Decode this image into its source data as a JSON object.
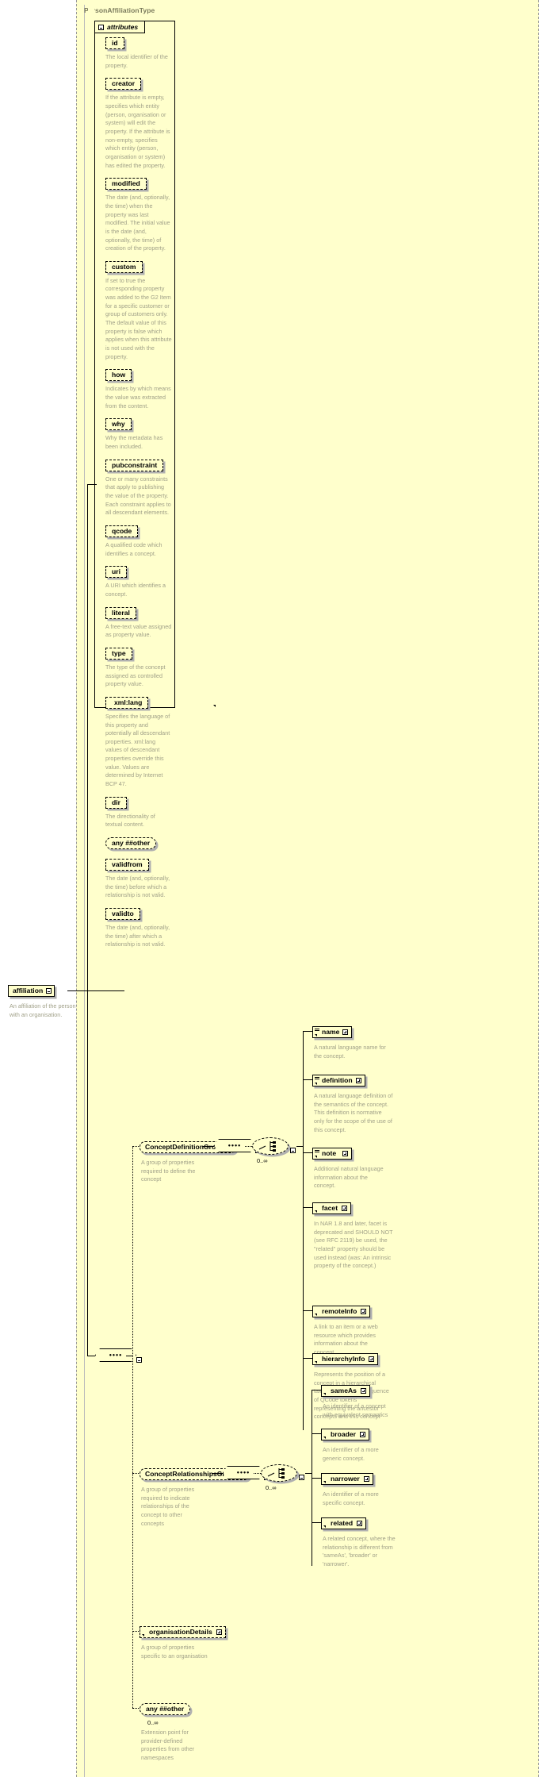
{
  "diagram": {
    "type": "xml-schema-diagram",
    "root_type": "PersonAffiliationType",
    "attributes_tab_label": "attributes",
    "source_element": {
      "name": "affiliation",
      "desc": "An affiliation of the person with an organisation."
    },
    "attributes": [
      {
        "name": "id",
        "desc": "The local identifier of the property."
      },
      {
        "name": "creator",
        "desc": "If the attribute is empty, specifies which entity (person, organisation or system) will edit the property. If the attribute is non-empty, specifies which entity (person, organisation or system) has edited the property."
      },
      {
        "name": "modified",
        "desc": "The date (and, optionally, the time) when the property was last modified. The initial value is the date (and, optionally, the time) of creation of the property."
      },
      {
        "name": "custom",
        "desc": "If set to true the corresponding property was added to the G2 Item for a specific customer or group of customers only. The default value of this property is false which applies when this attribute is not used with the property."
      },
      {
        "name": "how",
        "desc": "Indicates by which means the value was extracted from the content."
      },
      {
        "name": "why",
        "desc": "Why the metadata has been included."
      },
      {
        "name": "pubconstraint",
        "desc": "One or many constraints that apply to publishing the value of the property. Each constraint applies to all descendant elements."
      },
      {
        "name": "qcode",
        "desc": "A qualified code which identifies a concept."
      },
      {
        "name": "uri",
        "desc": "A URI which identifies a concept."
      },
      {
        "name": "literal",
        "desc": "A free-text value assigned as property value."
      },
      {
        "name": "type",
        "desc": "The type of the concept assigned as controlled property value."
      },
      {
        "name": "xml:lang",
        "desc": "Specifies the language of this property and potentially all descendant properties. xml:lang values of descendant properties override this value. Values are determined by Internet BCP 47."
      },
      {
        "name": "dir",
        "desc": "The directionality of textual content."
      },
      {
        "name": "any ##other",
        "kind": "any-attribute",
        "desc": ""
      },
      {
        "name": "validfrom",
        "desc": "The date (and, optionally, the time) before which a relationship is not valid."
      },
      {
        "name": "validto",
        "desc": "The date (and, optionally, the time) after which a relationship is not valid."
      }
    ],
    "groups": [
      {
        "name": "ConceptDefinitionGroup",
        "desc": "A group of properties required to define the concept",
        "occurrence": "0..∞",
        "children": [
          {
            "name": "name",
            "desc": "A natural language name for the concept."
          },
          {
            "name": "definition",
            "desc": "A natural language definition of the semantics of the concept. This definition is normative only for the scope of the use of this concept."
          },
          {
            "name": "note",
            "desc": "Additional natural language information about the concept."
          },
          {
            "name": "facet",
            "desc": "In NAR 1.8 and later, facet is deprecated and SHOULD NOT (see RFC 2119) be used, the \"related\" property should be used instead (was: An intrinsic property of the concept.)"
          },
          {
            "name": "remoteInfo",
            "desc": "A link to an item or a web resource which provides information about the concept"
          },
          {
            "name": "hierarchyInfo",
            "desc": "Represents the position of a concept in a hierarchical taxonomy tree by a sequence of QCode tokens representing the ancestor concepts and this concept"
          }
        ]
      },
      {
        "name": "ConceptRelationshipsGroup",
        "desc": "A group of properties required to indicate relationships of the concept to other concepts",
        "occurrence": "0..∞",
        "children": [
          {
            "name": "sameAs",
            "desc": "An identifier of a concept with equivalent semantics"
          },
          {
            "name": "broader",
            "desc": "An identifier of a more generic concept."
          },
          {
            "name": "narrower",
            "desc": "An identifier of a more specific concept."
          },
          {
            "name": "related",
            "desc": "A related concept, where the relationship is different from 'sameAs', 'broader' or 'narrower'."
          }
        ]
      }
    ],
    "extras": [
      {
        "name": "organisationDetails",
        "desc": "A group of properties specific to an organisation"
      },
      {
        "name": "any ##other",
        "kind": "any-element",
        "occurrence": "0..∞",
        "desc": "Extension point for provider-defined properties from other namespaces"
      }
    ],
    "colors": {
      "panel_background": "#ffffcc",
      "description_text": "#a0a088",
      "title_text": "#7a7a5c",
      "line": "#000000",
      "shadow": "#b0b0b0"
    }
  }
}
